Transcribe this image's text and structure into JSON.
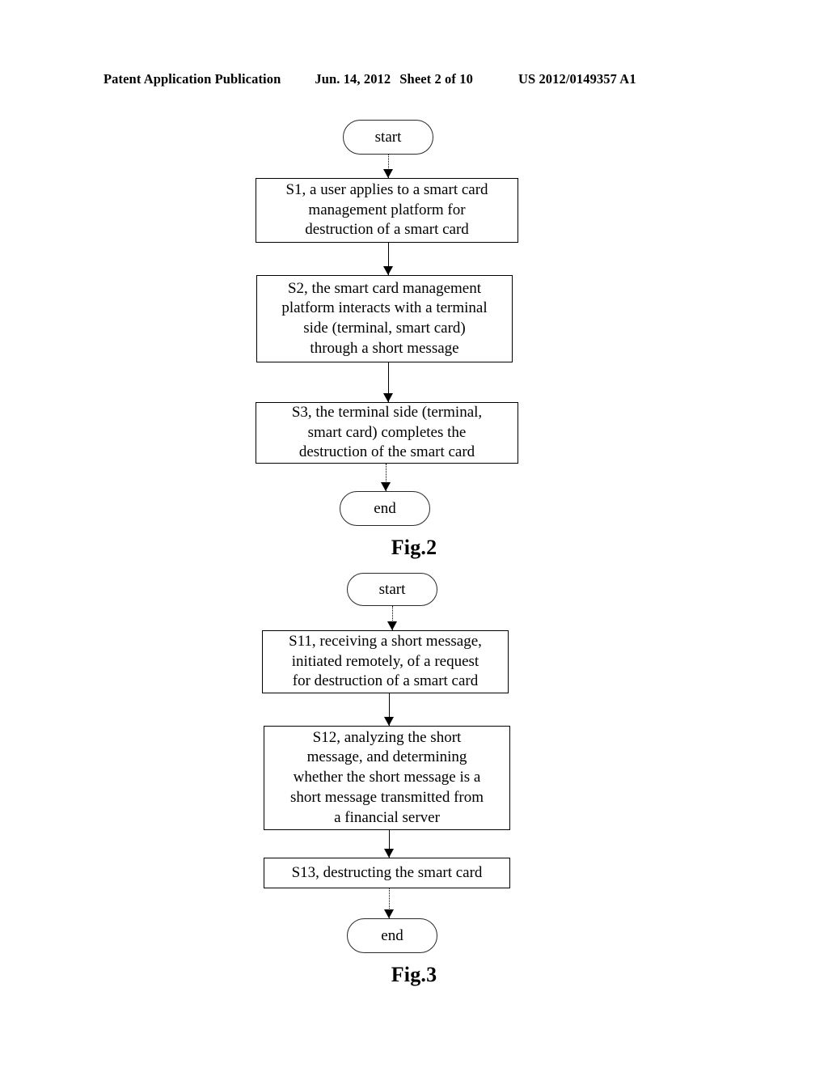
{
  "header": {
    "publication": "Patent Application Publication",
    "date": "Jun. 14, 2012",
    "sheet": "Sheet 2 of 10",
    "number": "US 2012/0149357 A1"
  },
  "figures": [
    {
      "caption": "Fig.2",
      "nodes": [
        {
          "id": "fig2-start",
          "type": "terminator",
          "label": "start"
        },
        {
          "id": "fig2-s1",
          "type": "process",
          "lines": [
            "S1, a user applies to a smart card",
            "management platform for",
            "destruction of a smart card"
          ]
        },
        {
          "id": "fig2-s2",
          "type": "process",
          "lines": [
            "S2, the smart card management",
            "platform interacts with a terminal",
            "side (terminal, smart card)",
            "through a short message"
          ]
        },
        {
          "id": "fig2-s3",
          "type": "process",
          "lines": [
            "S3, the terminal side (terminal,",
            "smart card) completes the",
            "destruction of the smart card"
          ]
        },
        {
          "id": "fig2-end",
          "type": "terminator",
          "label": "end"
        }
      ]
    },
    {
      "caption": "Fig.3",
      "nodes": [
        {
          "id": "fig3-start",
          "type": "terminator",
          "label": "start"
        },
        {
          "id": "fig3-s11",
          "type": "process",
          "lines": [
            "S11, receiving a short message,",
            "initiated remotely, of a request",
            "for destruction of a smart card"
          ]
        },
        {
          "id": "fig3-s12",
          "type": "process",
          "lines": [
            "S12, analyzing the short",
            "message, and determining",
            "whether the short message is a",
            "short message transmitted from",
            "a financial server"
          ]
        },
        {
          "id": "fig3-s13",
          "type": "process",
          "lines": [
            "S13, destructing the smart card"
          ]
        },
        {
          "id": "fig3-end",
          "type": "terminator",
          "label": "end"
        }
      ]
    }
  ],
  "fig2": {
    "start_label": "start",
    "s1_l1": "S1, a user applies to a smart card",
    "s1_l2": "management platform for",
    "s1_l3": "destruction of a smart card",
    "s2_l1": "S2, the smart card management",
    "s2_l2": "platform interacts with a terminal",
    "s2_l3": "side (terminal, smart card)",
    "s2_l4": "through a short message",
    "s3_l1": "S3, the terminal side (terminal,",
    "s3_l2": "smart card) completes the",
    "s3_l3": "destruction of the smart card",
    "end_label": "end",
    "caption": "Fig.2"
  },
  "fig3": {
    "start_label": "start",
    "s11_l1": "S11, receiving a short message,",
    "s11_l2": "initiated remotely, of a request",
    "s11_l3": "for destruction of a smart card",
    "s12_l1": "S12, analyzing the short",
    "s12_l2": "message, and determining",
    "s12_l3": "whether the short message is a",
    "s12_l4": "short message transmitted from",
    "s12_l5": "a financial server",
    "s13_l1": "S13, destructing the smart card",
    "end_label": "end",
    "caption": "Fig.3"
  },
  "colors": {
    "ink": "#000000",
    "paper": "#ffffff",
    "terminator_stroke": "#2a2a2a"
  }
}
